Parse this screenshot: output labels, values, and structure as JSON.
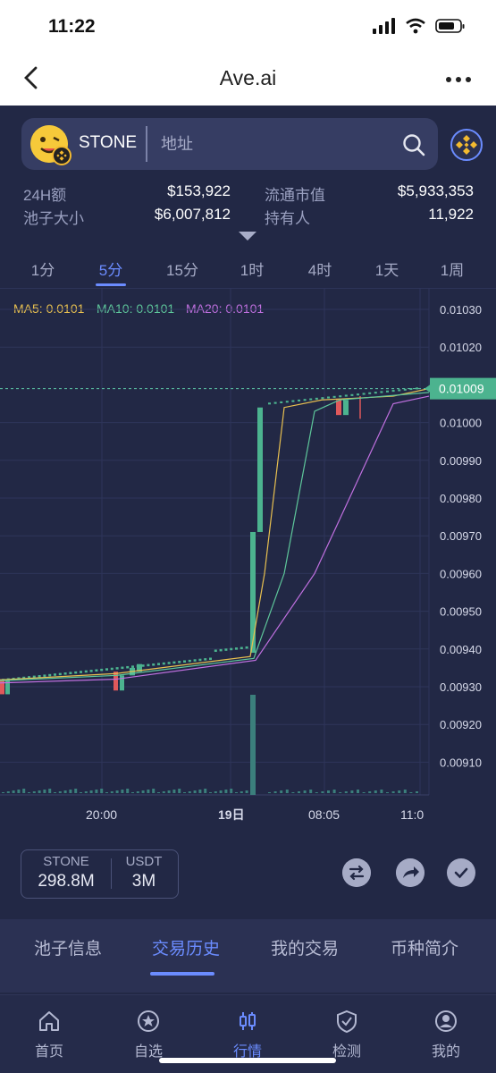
{
  "status": {
    "time": "11:22"
  },
  "nav": {
    "title": "Ave.ai"
  },
  "token": {
    "symbol": "STONE",
    "search_placeholder": "地址"
  },
  "stats": {
    "volume_24h_label": "24H额",
    "volume_24h": "$153,922",
    "pool_size_label": "池子大小",
    "pool_size": "$6,007,812",
    "market_cap_label": "流通市值",
    "market_cap": "$5,933,353",
    "holders_label": "持有人",
    "holders": "11,922"
  },
  "timeframes": [
    "1分",
    "5分",
    "15分",
    "1时",
    "4时",
    "1天",
    "1周"
  ],
  "active_timeframe": "5分",
  "ma": {
    "ma5": "MA5: 0.0101",
    "ma10": "MA10: 0.0101",
    "ma20": "MA20: 0.0101"
  },
  "chart_data": {
    "type": "candlestick",
    "y_ticks": [
      "0.01030",
      "0.01020",
      "0.01000",
      "0.00990",
      "0.00980",
      "0.00970",
      "0.00960",
      "0.00950",
      "0.00940",
      "0.00930",
      "0.00920",
      "0.00910"
    ],
    "current_price": "0.01009",
    "x_ticks": [
      "20:00",
      "19日",
      "08:05",
      "11:0"
    ],
    "ylim": [
      0.009,
      0.01035
    ],
    "grid": true,
    "colors": {
      "up": "#4cb38f",
      "down": "#e0595b",
      "ma5": "#e8c050",
      "ma10": "#5ec79b",
      "ma20": "#c070e0"
    }
  },
  "liquidity": {
    "sym1": "STONE",
    "val1": "298.8M",
    "sym2": "USDT",
    "val2": "3M"
  },
  "bottom_tabs": [
    "池子信息",
    "交易历史",
    "我的交易",
    "币种简介"
  ],
  "active_bottom_tab": "交易历史",
  "tabbar": [
    "首页",
    "自选",
    "行情",
    "检测",
    "我的"
  ],
  "active_tabbar": "行情"
}
